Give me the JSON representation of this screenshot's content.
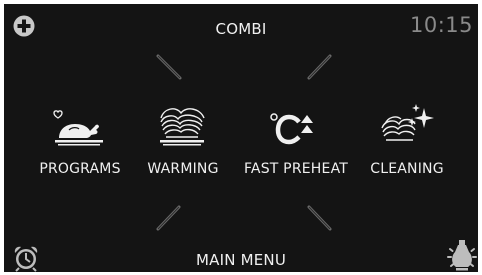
{
  "header": {
    "mode_title": "COMBI",
    "clock": "10:15"
  },
  "menu": {
    "items": [
      {
        "label": "PROGRAMS",
        "icon": "roast-chicken-icon"
      },
      {
        "label": "WARMING",
        "icon": "warming-dish-icon"
      },
      {
        "label": "FAST PREHEAT",
        "icon": "fast-preheat-icon"
      },
      {
        "label": "CLEANING",
        "icon": "cleaning-sparkle-icon"
      }
    ]
  },
  "footer": {
    "title": "MAIN MENU"
  },
  "colors": {
    "background": "#141414",
    "text": "#f0f0f0",
    "clock": "#8a8a8a",
    "icon_gray": "#bdbdbd",
    "divider": "#6e6e6e"
  }
}
